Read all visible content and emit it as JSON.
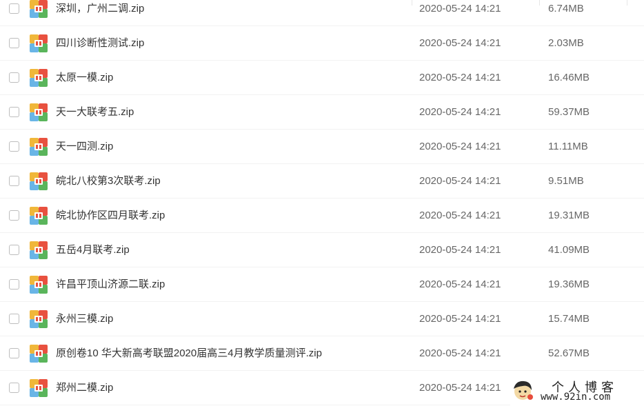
{
  "files": [
    {
      "name": "深圳，广州二调.zip",
      "date": "2020-05-24 14:21",
      "size": "6.74MB"
    },
    {
      "name": "四川诊断性测试.zip",
      "date": "2020-05-24 14:21",
      "size": "2.03MB"
    },
    {
      "name": "太原一模.zip",
      "date": "2020-05-24 14:21",
      "size": "16.46MB"
    },
    {
      "name": "天一大联考五.zip",
      "date": "2020-05-24 14:21",
      "size": "59.37MB"
    },
    {
      "name": "天一四测.zip",
      "date": "2020-05-24 14:21",
      "size": "11.11MB"
    },
    {
      "name": "皖北八校第3次联考.zip",
      "date": "2020-05-24 14:21",
      "size": "9.51MB"
    },
    {
      "name": "皖北协作区四月联考.zip",
      "date": "2020-05-24 14:21",
      "size": "19.31MB"
    },
    {
      "name": "五岳4月联考.zip",
      "date": "2020-05-24 14:21",
      "size": "41.09MB"
    },
    {
      "name": "许昌平顶山济源二联.zip",
      "date": "2020-05-24 14:21",
      "size": "19.36MB"
    },
    {
      "name": "永州三模.zip",
      "date": "2020-05-24 14:21",
      "size": "15.74MB"
    },
    {
      "name": "原创卷10 华大新高考联盟2020届高三4月教学质量测评.zip",
      "date": "2020-05-24 14:21",
      "size": "52.67MB"
    },
    {
      "name": "郑州二模.zip",
      "date": "2020-05-24 14:21",
      "size": ""
    }
  ],
  "icons": {
    "file_icon": "zip-archive-icon",
    "checkbox": "checkbox-unchecked"
  },
  "colors": {
    "icon_top_left": "#f0b73a",
    "icon_top_right": "#e8513f",
    "icon_bottom_left": "#69b5e6",
    "icon_bottom_right": "#5ab55b",
    "icon_center": "#e8513f"
  },
  "watermark": {
    "title": "个人博客",
    "url": "www.92in.com"
  }
}
